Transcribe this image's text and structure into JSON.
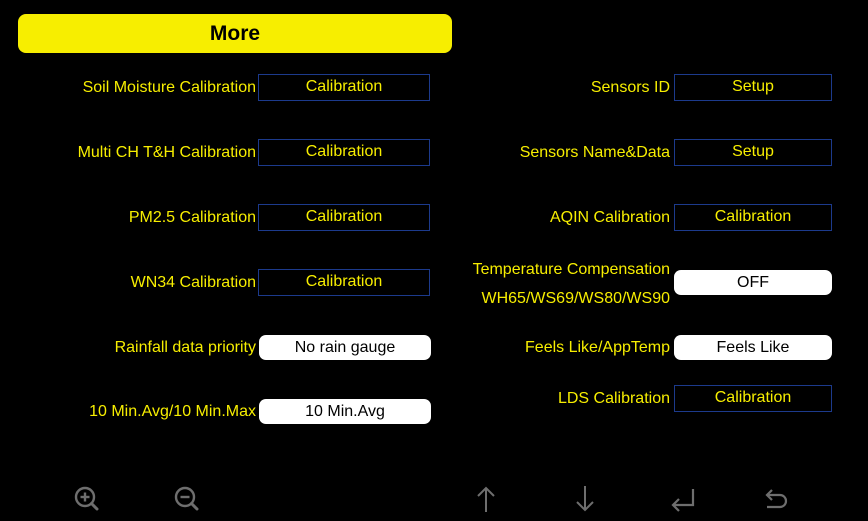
{
  "header": {
    "title": "More"
  },
  "left": [
    {
      "label": "Soil Moisture Calibration",
      "value": "Calibration"
    },
    {
      "label": "Multi CH T&H Calibration",
      "value": "Calibration"
    },
    {
      "label": "PM2.5 Calibration",
      "value": "Calibration"
    },
    {
      "label": "WN34 Calibration",
      "value": "Calibration"
    },
    {
      "label": "Rainfall data priority",
      "value": "No rain gauge"
    },
    {
      "label": "10 Min.Avg/10 Min.Max",
      "value": "10 Min.Avg"
    }
  ],
  "right": [
    {
      "label": "Sensors ID",
      "value": "Setup"
    },
    {
      "label": "Sensors Name&Data",
      "value": "Setup"
    },
    {
      "label": "AQIN Calibration",
      "value": "Calibration"
    },
    {
      "label_line1": "Temperature Compensation",
      "label_line2": "WH65/WS69/WS80/WS90",
      "value": "OFF"
    },
    {
      "label": "Feels Like/AppTemp",
      "value": "Feels Like"
    },
    {
      "label": "LDS Calibration",
      "value": "Calibration"
    }
  ],
  "toolbar": {
    "icons": [
      "zoom-in-icon",
      "zoom-out-icon",
      "arrow-up-icon",
      "arrow-down-icon",
      "enter-icon",
      "back-icon"
    ]
  },
  "colors": {
    "accent": "#f7ee00",
    "box_border": "#1c3a8c",
    "background": "#000000",
    "icon": "#6e6e6e"
  }
}
